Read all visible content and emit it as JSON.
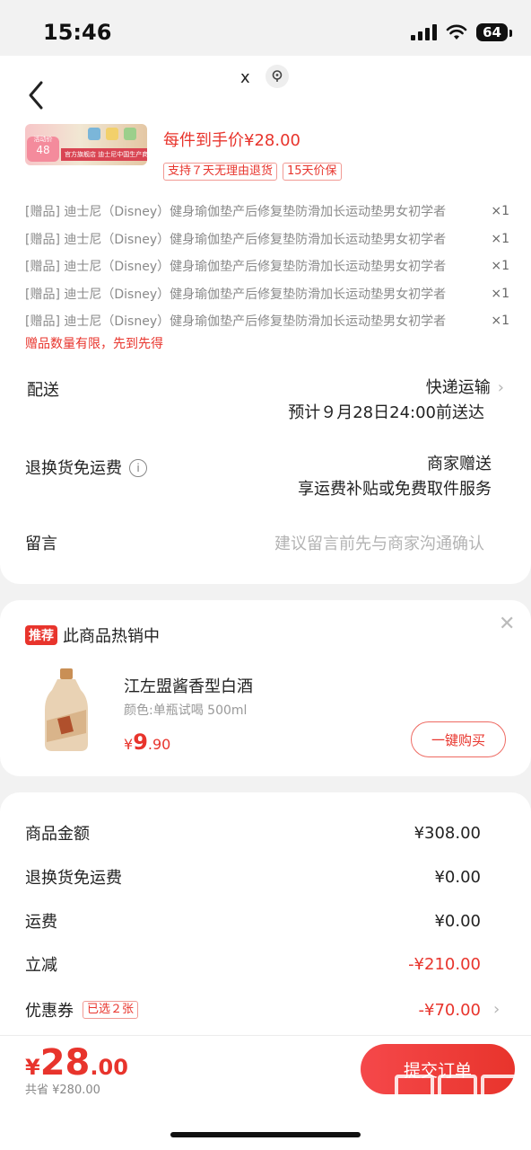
{
  "status_bar": {
    "time": "15:46",
    "battery": "64"
  },
  "header": {
    "close_label": "x"
  },
  "product": {
    "thumb_badge_top": "活动价",
    "thumb_badge_price": "48",
    "thumb_strip_text": "官方旗舰店 迪士尼中国生产商",
    "price_text": "每件到手价¥28.00",
    "service_tags": [
      "支持７天无理由退货",
      "15天价保"
    ]
  },
  "gifts": [
    {
      "name": "[赠品] 迪士尼（Disney）健身瑜伽垫产后修复垫防滑加长运动垫男女初学者",
      "qty": "×1"
    },
    {
      "name": "[赠品] 迪士尼（Disney）健身瑜伽垫产后修复垫防滑加长运动垫男女初学者",
      "qty": "×1"
    },
    {
      "name": "[赠品] 迪士尼（Disney）健身瑜伽垫产后修复垫防滑加长运动垫男女初学者",
      "qty": "×1"
    },
    {
      "name": "[赠品] 迪士尼（Disney）健身瑜伽垫产后修复垫防滑加长运动垫男女初学者",
      "qty": "×1"
    },
    {
      "name": "[赠品] 迪士尼（Disney）健身瑜伽垫产后修复垫防滑加长运动垫男女初学者",
      "qty": "×1"
    }
  ],
  "gift_note": "赠品数量有限，先到先得",
  "delivery": {
    "label": "配送",
    "method": "快递运输",
    "eta": "预计９月28日24:00前送达"
  },
  "return_shipping": {
    "label": "退换货免运费",
    "value": "商家赠送",
    "desc": "享运费补贴或免费取件服务"
  },
  "message": {
    "label": "留言",
    "placeholder": "建议留言前先与商家沟通确认"
  },
  "recommend": {
    "badge": "推荐",
    "title": "此商品热销中",
    "item_name": "江左盟酱香型白酒",
    "item_spec": "颜色:单瓶试喝 500ml",
    "price_currency": "¥",
    "price_int": "9",
    "price_dec": ".90",
    "buy_label": "一键购买"
  },
  "summary": {
    "goods_label": "商品金额",
    "goods_value": "¥308.00",
    "return_label": "退换货免运费",
    "return_value": "¥0.00",
    "shipping_label": "运费",
    "shipping_value": "¥0.00",
    "discount_label": "立减",
    "discount_value": "-¥210.00",
    "coupon_label": "优惠券",
    "coupon_tag": "已选２张",
    "coupon_value": "-¥70.00"
  },
  "footer": {
    "total_currency": "¥",
    "total_int": "28",
    "total_dec": ".00",
    "saved": "共省 ¥280.00",
    "submit_label": "提交订单"
  },
  "watermark": {
    "text": "zhizhizhi.com"
  },
  "colors": {
    "accent": "#e8342c",
    "background": "#f2f2f2",
    "card": "#ffffff"
  }
}
